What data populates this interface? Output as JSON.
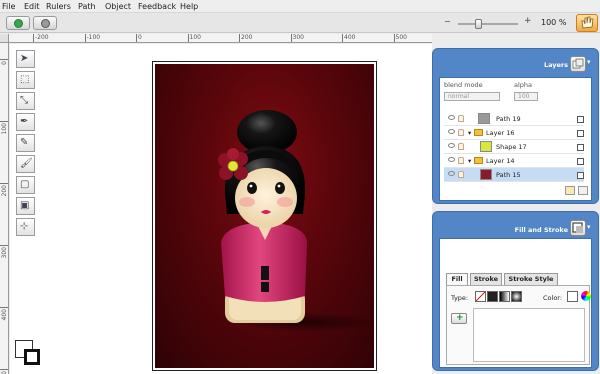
{
  "menu": [
    "File",
    "Edit",
    "Rulers",
    "Path",
    "Object",
    "Feedback",
    "Help"
  ],
  "zoom": {
    "minus": "−",
    "plus": "+",
    "value": "100 %",
    "level": 0.33
  },
  "ruler_top": [
    "-200",
    "-100",
    "0",
    "100",
    "200",
    "300",
    "400",
    "500",
    "600",
    "700",
    "800"
  ],
  "ruler_left": [
    "0",
    "100",
    "200",
    "300",
    "400",
    "500"
  ],
  "layers_panel": {
    "title": "Layers",
    "blend_label": "blend mode",
    "blend_value": "normal",
    "alpha_label": "alpha",
    "alpha_value": "100",
    "rows": [
      {
        "name": "Path 19",
        "expander": "",
        "folder": false,
        "thumb": "#999999",
        "selected": false
      },
      {
        "name": "Layer 16",
        "expander": "▾",
        "folder": true,
        "thumb": "",
        "selected": false
      },
      {
        "name": "Shape 17",
        "expander": "",
        "folder": false,
        "thumb": "#d8e840",
        "selected": false
      },
      {
        "name": "Layer 14",
        "expander": "▾",
        "folder": true,
        "thumb": "",
        "selected": false
      },
      {
        "name": "Path 15",
        "expander": "",
        "folder": false,
        "thumb": "#8a1a2a",
        "selected": true
      }
    ]
  },
  "fill_panel": {
    "title": "Fill and Stroke",
    "tabs": [
      "Fill",
      "Stroke",
      "Stroke Style"
    ],
    "type_label": "Type:",
    "color_label": "Color:",
    "add_label": "+"
  }
}
